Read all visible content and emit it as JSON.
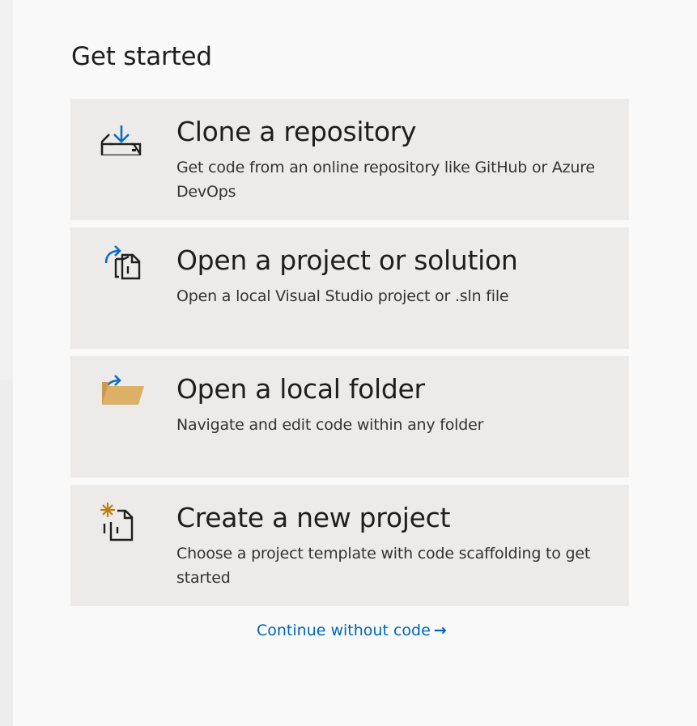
{
  "title": "Get started",
  "actions": [
    {
      "title": "Clone a repository",
      "description": "Get code from an online repository like GitHub or Azure DevOps",
      "icon": "clone-repository-icon"
    },
    {
      "title": "Open a project or solution",
      "description": "Open a local Visual Studio project or .sln file",
      "icon": "open-project-icon"
    },
    {
      "title": "Open a local folder",
      "description": "Navigate and edit code within any folder",
      "icon": "open-folder-icon"
    },
    {
      "title": "Create a new project",
      "description": "Choose a project template with code scaffolding to get started",
      "icon": "new-project-icon"
    }
  ],
  "continue_link": {
    "label": "Continue without code",
    "arrow": "→"
  },
  "colors": {
    "card_background": "#ecebea",
    "link": "#0066b8",
    "accent_blue": "#0e6cc4",
    "folder": "#dcb067",
    "sparkle": "#c27d0e"
  }
}
